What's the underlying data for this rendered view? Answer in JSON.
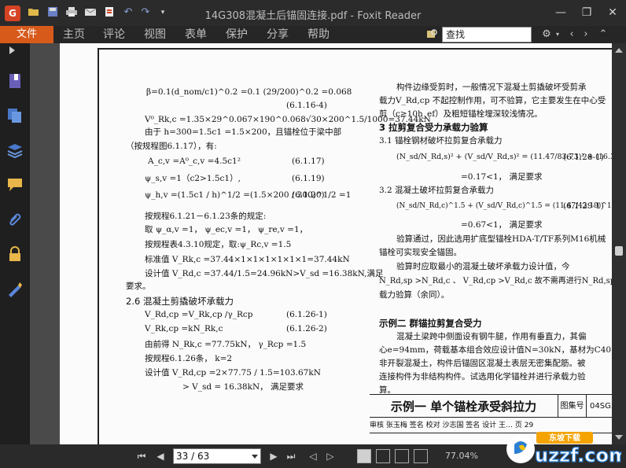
{
  "window": {
    "title": "14G308混凝土后锚固连接.pdf - Foxit Reader",
    "app_logo": "G",
    "controls": [
      "minimize-icon",
      "restore-icon",
      "close-icon"
    ]
  },
  "quick_access": [
    "open-folder-icon",
    "save-icon",
    "print-icon",
    "email-icon",
    "pdf-create-icon",
    "undo-icon",
    "redo-icon",
    "customize-icon"
  ],
  "ribbon": {
    "file_tab": "文件",
    "tabs": [
      "主页",
      "评论",
      "视图",
      "表单",
      "保护",
      "分享",
      "帮助"
    ],
    "search_placeholder": "查找"
  },
  "sidebar": {
    "icons": [
      "expand-arrow-icon",
      "bookmark-icon",
      "pages-icon",
      "layers-icon",
      "comments-icon",
      "attachments-icon",
      "security-icon",
      "signature-icon"
    ]
  },
  "document": {
    "left_lines": [
      "β=0.1(d_nom/c1)^0.2 =0.1 (29/200)^0.2 =0.068",
      "(6.1.16-4)",
      "V⁰_Rk,c =1.35×29^0.067×190^0.068√30×200^1.5/1000=37.44kN",
      "由于 h=300=1.5c1 =1.5×200，且锚栓位于梁中部",
      "（按规程图6.1.17），有:",
      "A_c,v =A⁰_c,v =4.5c1²",
      "(6.1.17)",
      "ψ_s,v =1（c2>1.5c1）,",
      "(6.1.19)",
      "ψ_h,v =(1.5c1 / h)^1/2 =(1.5×200 / 300)^1/2 =1",
      "(6.1.20)",
      "按规程6.1.21－6.1.23条的规定:",
      "取   ψ_α,v =1，  ψ_ec,v =1，  ψ_re,v =1，",
      "按规程表4.3.10规定，取:ψ_Rc,v =1.5",
      "标准值   V_Rk,c =37.44×1×1×1×1×1×1=37.44kN",
      "设计值   V_Rd,c =37.44/1.5=24.96kN>V_sd =16.38kN,满足",
      "要求。",
      "V_Rd,cp =V_Rk,cp /γ_Rcp",
      "(6.1.26-1)",
      "V_Rk,cp =kN_Rk,c",
      "(6.1.26-2)",
      "由前得   N_Rk,c =77.75kN，        γ_Rcp =1.5",
      "按规程6.1.26条，  k=2",
      "设计值   V_Rd,cp =2×77.75 / 1.5=103.67kN",
      "> V_sd = 16.38kN，   满足要求"
    ],
    "left_heading": "2.6 混凝土剪撬破坏承载力",
    "right_lines": [
      "构件边缘受剪时，一般情况下混凝土剪撬破坏受剪承",
      "载力V_Rd,cp 不起控制作用，可不验算，它主要发生在中心受",
      "剪（c≥10h_ef）及粗短锚栓埋深较浅情况。",
      "3.1 锚栓钢材破坏拉剪复合承载力",
      "(N_sd/N_Rd,s)² + (V_sd/V_Rd,s)² = (11.47/83.73)² + (16.38/41.87)²",
      "(6.1.28-1)",
      "=0.17<1，  满足要求",
      "3.2 混凝土破坏拉剪复合承载力",
      "(N_sd/N_Rd,c)^1.5 + (V_sd/V_Rd,c)^1.5 = (11.47/43.19)^1.5 + (16.38/24.96)^1.5",
      "(6.1.29-1)",
      "=0.67<1，  满足要求",
      "验算通过，因此选用扩底型锚栓HDA-T/TF系列M16机械",
      "锚栓可实现安全锚固。",
      "验算时应取最小的混凝土破坏承载力设计值，今",
      "N_Rd,sp >N_Rd,c 、  V_Rd,cp >V_Rd,c 故不需再进行N_Rd,sp 及V_Rd,cp 的复合承",
      "载力验算（余同）。",
      "混凝土梁跨中侧面设有钢牛腿，作用有垂直力，其偏",
      "心e=94mm，荷载基本组合效应设计值N=30kN，基材为C40",
      "非开裂混凝土，构件后锚固区混凝土表层无密集配筋。被",
      "连接构件为非结构构件。试选用化学锚栓并进行承载力验",
      "算。"
    ],
    "right_heading_3": "3   拉剪复合受力承载力验算",
    "right_heading_ex2": "示例二   群锚拉剪复合受力",
    "titleblock": {
      "title": "示例一   单个锚栓承受斜拉力",
      "atlas_label": "图集号",
      "atlas_no": "04SG308",
      "row2": "审核 张玉梅  签名   校对 沙志国  签名   设计 王…   页   29"
    }
  },
  "statusbar": {
    "page_value": "33 / 63",
    "zoom": "77.04%",
    "watermark_text": "uzzf.com",
    "watermark_tag": "东坡下载"
  },
  "colors": {
    "accent": "#d75a1b",
    "titlebar_bg": "#2b2b2b",
    "ribbon_bg": "#262626",
    "sidebar_bg": "#1f1f1f",
    "doc_bg": "#4a4a4a",
    "page_bg": "#fbfbfb"
  }
}
